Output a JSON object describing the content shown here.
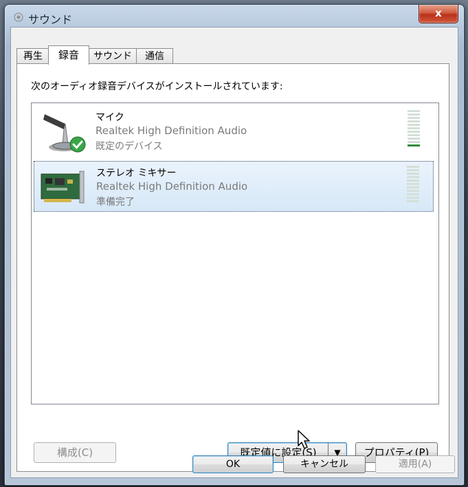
{
  "window": {
    "title": "サウンド",
    "close_label": "x"
  },
  "tabs": [
    {
      "label": "再生",
      "active": false
    },
    {
      "label": "録音",
      "active": true
    },
    {
      "label": "サウンド",
      "active": false
    },
    {
      "label": "通信",
      "active": false
    }
  ],
  "instruction": "次のオーディオ録音デバイスがインストールされています:",
  "devices": [
    {
      "name": "マイク",
      "driver": "Realtek High Definition Audio",
      "status": "既定のデバイス",
      "icon": "microphone-icon",
      "default_badge": "check-icon",
      "selected": false,
      "level_fraction": 0.1
    },
    {
      "name": "ステレオ ミキサー",
      "driver": "Realtek High Definition Audio",
      "status": "準備完了",
      "icon": "sound-card-icon",
      "selected": true,
      "level_fraction": 0.0
    }
  ],
  "buttons": {
    "configure": "構成(C)",
    "set_default": "既定値に設定(S)",
    "properties": "プロパティ(P)",
    "ok": "OK",
    "cancel": "キャンセル",
    "apply": "適用(A)"
  },
  "colors": {
    "level_active": "#2e8b3a",
    "selection": "#d7e8f8",
    "close_button": "#c8472b"
  }
}
